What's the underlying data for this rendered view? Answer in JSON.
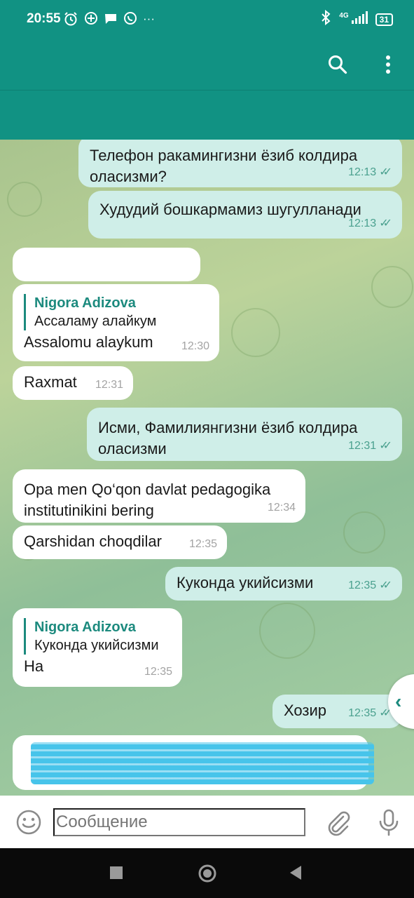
{
  "status_bar": {
    "time": "20:55",
    "left_icons": [
      "alarm-icon",
      "plus-circle-icon",
      "chat-icon",
      "whatsapp-icon",
      "more-dots-icon"
    ],
    "more": "···",
    "network": "4G",
    "battery": "31"
  },
  "toolbar": {
    "search_icon": "search-icon",
    "menu_icon": "more-vert-icon"
  },
  "messages": [
    {
      "dir": "out",
      "text": "Телефон ракамингизни ёзиб колдира оласизми?",
      "time": "12:13"
    },
    {
      "dir": "out",
      "text": "Худудий бошкармамиз шугулланади",
      "time": "12:13"
    },
    {
      "dir": "in",
      "text": "",
      "time": ""
    },
    {
      "dir": "in",
      "reply_name": "Nigora Adizova",
      "reply_text": "Ассаламу алайкум",
      "text": "Assalomu alaykum",
      "time": "12:30"
    },
    {
      "dir": "in",
      "text": "Raxmat",
      "time": "12:31"
    },
    {
      "dir": "out",
      "text": "Исми, Фамилиянгизни ёзиб колдира оласизми",
      "time": "12:31"
    },
    {
      "dir": "in",
      "text": "Opa men Qo‘qon davlat pedagogika institutinikini bering",
      "time": "12:34"
    },
    {
      "dir": "in",
      "text": "Qarshidan choqdilar",
      "time": "12:35"
    },
    {
      "dir": "out",
      "text": "Куконда укийсизми",
      "time": "12:35"
    },
    {
      "dir": "in",
      "reply_name": "Nigora Adizova",
      "reply_text": "Куконда укийсизми",
      "text": "На",
      "time": "12:35"
    },
    {
      "dir": "out",
      "text": "Хозир",
      "time": "12:35"
    }
  ],
  "composer": {
    "placeholder": "Сообщение"
  },
  "colors": {
    "header": "#119283",
    "outgoing_bubble": "#cfeee8",
    "incoming_bubble": "#ffffff",
    "accent": "#1c8a7e",
    "redaction": "#47c4ea"
  }
}
